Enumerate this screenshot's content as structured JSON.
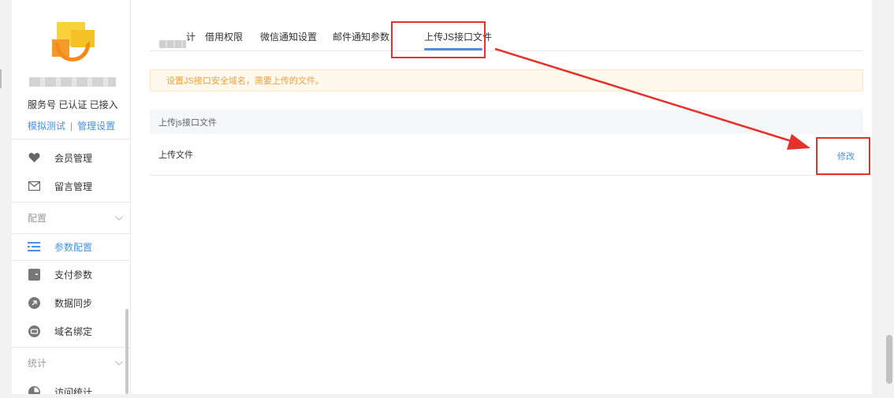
{
  "sidebar": {
    "account": {
      "status": "服务号 已认证 已接入",
      "links": [
        {
          "label": "模拟测试"
        },
        {
          "label": "管理设置"
        }
      ],
      "separator": "|"
    },
    "menu_top": [
      {
        "label": "会员管理",
        "icon": "heart-icon"
      },
      {
        "label": "留言管理",
        "icon": "mail-icon"
      }
    ],
    "sections": [
      {
        "title": "配置",
        "items": [
          {
            "label": "参数配置",
            "icon": "list-icon",
            "active": true
          },
          {
            "label": "支付参数",
            "icon": "payment-card-icon"
          },
          {
            "label": "数据同步",
            "icon": "sync-icon"
          },
          {
            "label": "域名绑定",
            "icon": "domain-icon"
          }
        ]
      },
      {
        "title": "统计",
        "items": [
          {
            "label": "访问统计",
            "icon": "stats-icon"
          }
        ]
      }
    ]
  },
  "tabs": [
    {
      "label": "计",
      "blurred": true
    },
    {
      "label": "借用权限"
    },
    {
      "label": "微信通知设置"
    },
    {
      "label": "邮件通知参数"
    },
    {
      "label": "上传JS接口文件",
      "active": true
    }
  ],
  "notice": "设置JS接口安全域名，需要上传的文件。",
  "panel": {
    "header": "上传js接口文件",
    "row_label": "上传文件",
    "action": "修改"
  },
  "colors": {
    "accent": "#4a90e2",
    "annotation": "#e8302a",
    "notice_text": "#f0a03c",
    "notice_bg": "#fff8ec"
  }
}
